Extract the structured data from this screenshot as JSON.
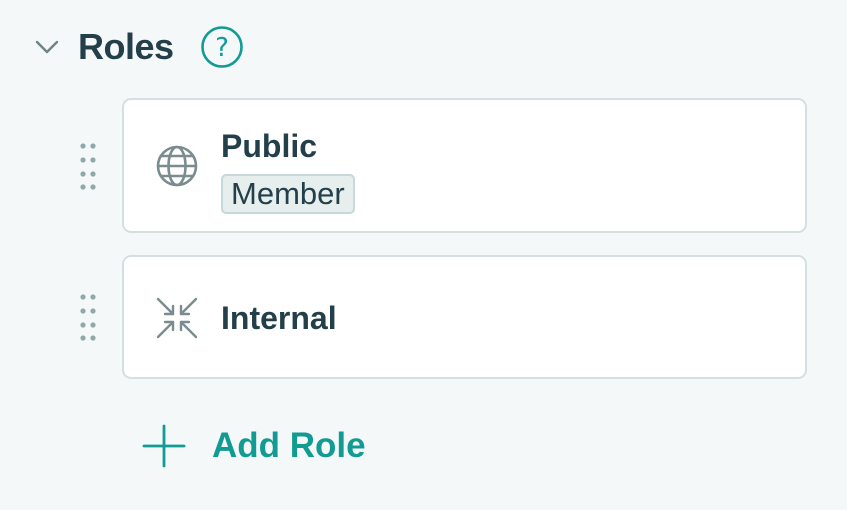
{
  "section": {
    "title": "Roles",
    "help_symbol": "?"
  },
  "roles": [
    {
      "name": "Public",
      "icon": "globe-icon",
      "tag": "Member"
    },
    {
      "name": "Internal",
      "icon": "internal-arrows-icon"
    }
  ],
  "add_role": {
    "label": "Add Role",
    "icon": "plus-icon"
  },
  "colors": {
    "background": "#f5f8f9",
    "text": "#23404a",
    "accent": "#119b93",
    "muted_icon": "#7a8c8f",
    "card_border": "#d5dfe2",
    "tag_background": "#e6eeee"
  }
}
